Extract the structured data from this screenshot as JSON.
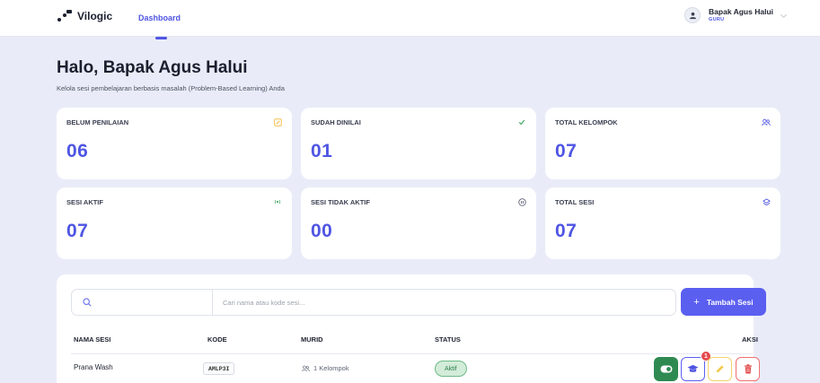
{
  "app": {
    "logo_text": "Vilogic"
  },
  "nav": {
    "dashboard_label": "Dashboard"
  },
  "user": {
    "name": "Bapak Agus Halui",
    "role": "GURU"
  },
  "header": {
    "greeting": "Halo, Bapak Agus Halui",
    "subtitle": "Kelola sesi pembelajaran berbasis masalah (Problem-Based Learning) Anda"
  },
  "stats": [
    {
      "label": "BELUM PENILAIAN",
      "value": "06",
      "icon": "edit-icon",
      "icon_color": "#f2b93b"
    },
    {
      "label": "SUDAH DINILAI",
      "value": "01",
      "icon": "check-icon",
      "icon_color": "#3aa45f"
    },
    {
      "label": "TOTAL KELOMPOK",
      "value": "07",
      "icon": "users-icon",
      "icon_color": "#4f55e3"
    },
    {
      "label": "SESI AKTIF",
      "value": "07",
      "icon": "broadcast-icon",
      "icon_color": "#3aa45f"
    },
    {
      "label": "SESI TIDAK AKTIF",
      "value": "00",
      "icon": "pause-icon",
      "icon_color": "#5e6373"
    },
    {
      "label": "TOTAL SESI",
      "value": "07",
      "icon": "layers-icon",
      "icon_color": "#4f55e3"
    }
  ],
  "search": {
    "placeholder": "Cari nama atau kode sesi..."
  },
  "add_button": {
    "label": "Tambah Sesi"
  },
  "table": {
    "headers": {
      "name": "NAMA SESI",
      "code": "KODE",
      "students": "MURID",
      "status": "STATUS",
      "actions": "AKSI"
    },
    "rows": [
      {
        "name": "Prana Wash",
        "code": "AMLP3I",
        "students": "1 Kelompok",
        "status": "Aktif",
        "notification_count": "1"
      }
    ]
  },
  "colors": {
    "accent": "#4f55e3",
    "button": "#5b5ff0",
    "active_green": "#2f8a52",
    "delete_red": "#ef7070"
  }
}
